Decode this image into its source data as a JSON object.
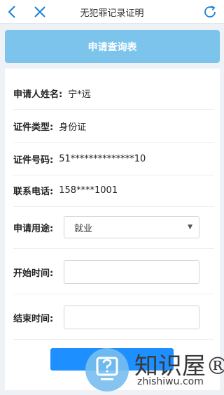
{
  "nav": {
    "title": "无犯罪记录证明"
  },
  "header": {
    "title": "申请查询表"
  },
  "form": {
    "name": {
      "label": "申请人姓名:",
      "value": "宁*远"
    },
    "id_type": {
      "label": "证件类型:",
      "value": "身份证"
    },
    "id_number": {
      "label": "证件号码:",
      "value": "51**************10"
    },
    "phone": {
      "label": "联系电话:",
      "value": "158****1001"
    },
    "purpose": {
      "label": "申请用途:",
      "selected": "就业"
    },
    "start_time": {
      "label": "开始时间:",
      "value": ""
    },
    "end_time": {
      "label": "结束时间:",
      "value": ""
    }
  },
  "watermark": {
    "brand": "知识屋®",
    "url": "zhishiwu.com"
  },
  "icons": {
    "back": "chevron-left-icon",
    "close": "close-icon",
    "refresh": "refresh-icon",
    "watermark": "question-monitor-icon"
  },
  "colors": {
    "header_bar": "#7cc4ec",
    "submit_button": "#1e8fff",
    "nav_icons": "#1a7fd6"
  }
}
